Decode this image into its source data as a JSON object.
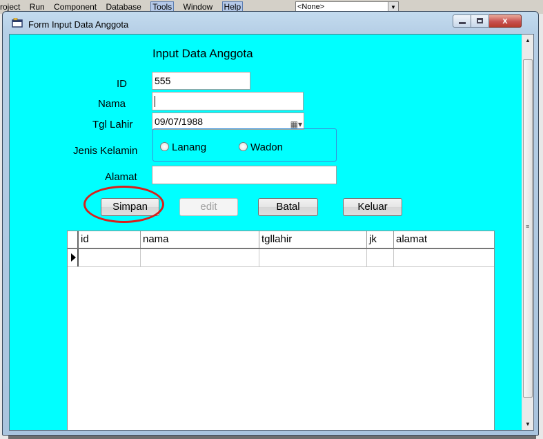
{
  "ide": {
    "menu": [
      "roject",
      "Run",
      "Component",
      "Database",
      "Tools",
      "Window",
      "Help"
    ],
    "combo_value": "<None>"
  },
  "window": {
    "title": "Form Input Data Anggota",
    "close_glyph": "x"
  },
  "form": {
    "heading": "Input Data Anggota",
    "labels": {
      "id": "ID",
      "nama": "Nama",
      "tgl_lahir": "Tgl Lahir",
      "jenis_kelamin": "Jenis Kelamin",
      "alamat": "Alamat"
    },
    "values": {
      "id": "555",
      "nama": "",
      "tgl_lahir": "09/07/1988",
      "alamat": ""
    },
    "radio_options": [
      "Lanang",
      "Wadon"
    ]
  },
  "buttons": {
    "simpan": "Simpan",
    "edit": "edit",
    "batal": "Batal",
    "keluar": "Keluar"
  },
  "grid": {
    "columns": [
      "id",
      "nama",
      "tgllahir",
      "jk",
      "alamat"
    ]
  }
}
